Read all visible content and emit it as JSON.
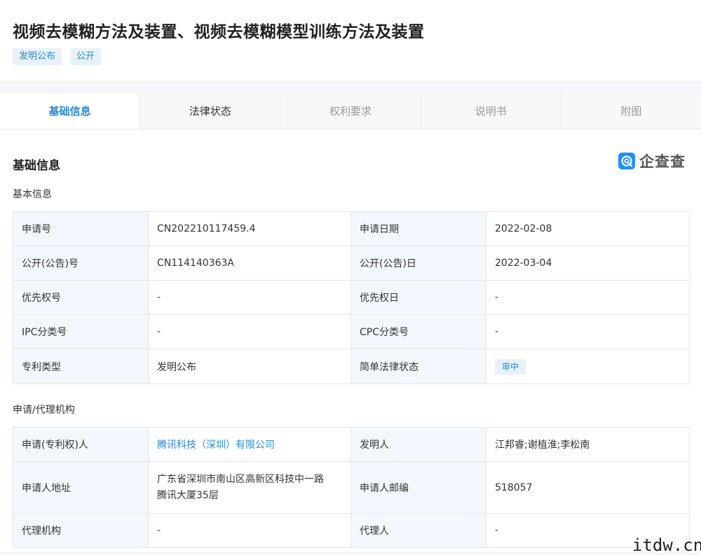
{
  "header": {
    "title": "视频去模糊方法及装置、视频去模糊模型训练方法及装置",
    "tags": [
      "发明公布",
      "公开"
    ]
  },
  "main": {
    "tabs": [
      {
        "label": "基础信息"
      },
      {
        "label": "法律状态"
      },
      {
        "label": "权利要求"
      },
      {
        "label": "说明书"
      },
      {
        "label": "附图"
      }
    ],
    "section_title": "基础信息",
    "logo_text": "企查查",
    "basic_info": {
      "title": "基本信息",
      "rows": [
        {
          "l1": "申请号",
          "v1": "CN202210117459.4",
          "l2": "申请日期",
          "v2": "2022-02-08"
        },
        {
          "l1": "公开(公告)号",
          "v1": "CN114140363A",
          "l2": "公开(公告)日",
          "v2": "2022-03-04"
        },
        {
          "l1": "优先权号",
          "v1": "-",
          "l2": "优先权日",
          "v2": "-"
        },
        {
          "l1": "IPC分类号",
          "v1": "-",
          "l2": "CPC分类号",
          "v2": "-"
        },
        {
          "l1": "专利类型",
          "v1": "发明公布",
          "l2": "简单法律状态",
          "v2": "审中"
        }
      ]
    },
    "applicant_info": {
      "title": "申请/代理机构",
      "rows": [
        {
          "l1": "申请(专利权)人",
          "v1": "腾讯科技（深圳）有限公司",
          "l2": "发明人",
          "v2": "江邦睿;谢植淮;李松南"
        },
        {
          "l1": "申请人地址",
          "v1_line1": "广东省深圳市南山区高新区科技中一路",
          "v1_line2": "腾讯大厦35层",
          "l2": "申请人邮编",
          "v2": "518057"
        },
        {
          "l1": "代理机构",
          "v1": "-",
          "l2": "代理人",
          "v2": "-"
        }
      ]
    }
  },
  "watermark": "itdw.cn",
  "colors": {
    "accent": "#2a8ad8",
    "label_bg": "#f2f8fd",
    "logo_blue": "#1e90ff"
  }
}
